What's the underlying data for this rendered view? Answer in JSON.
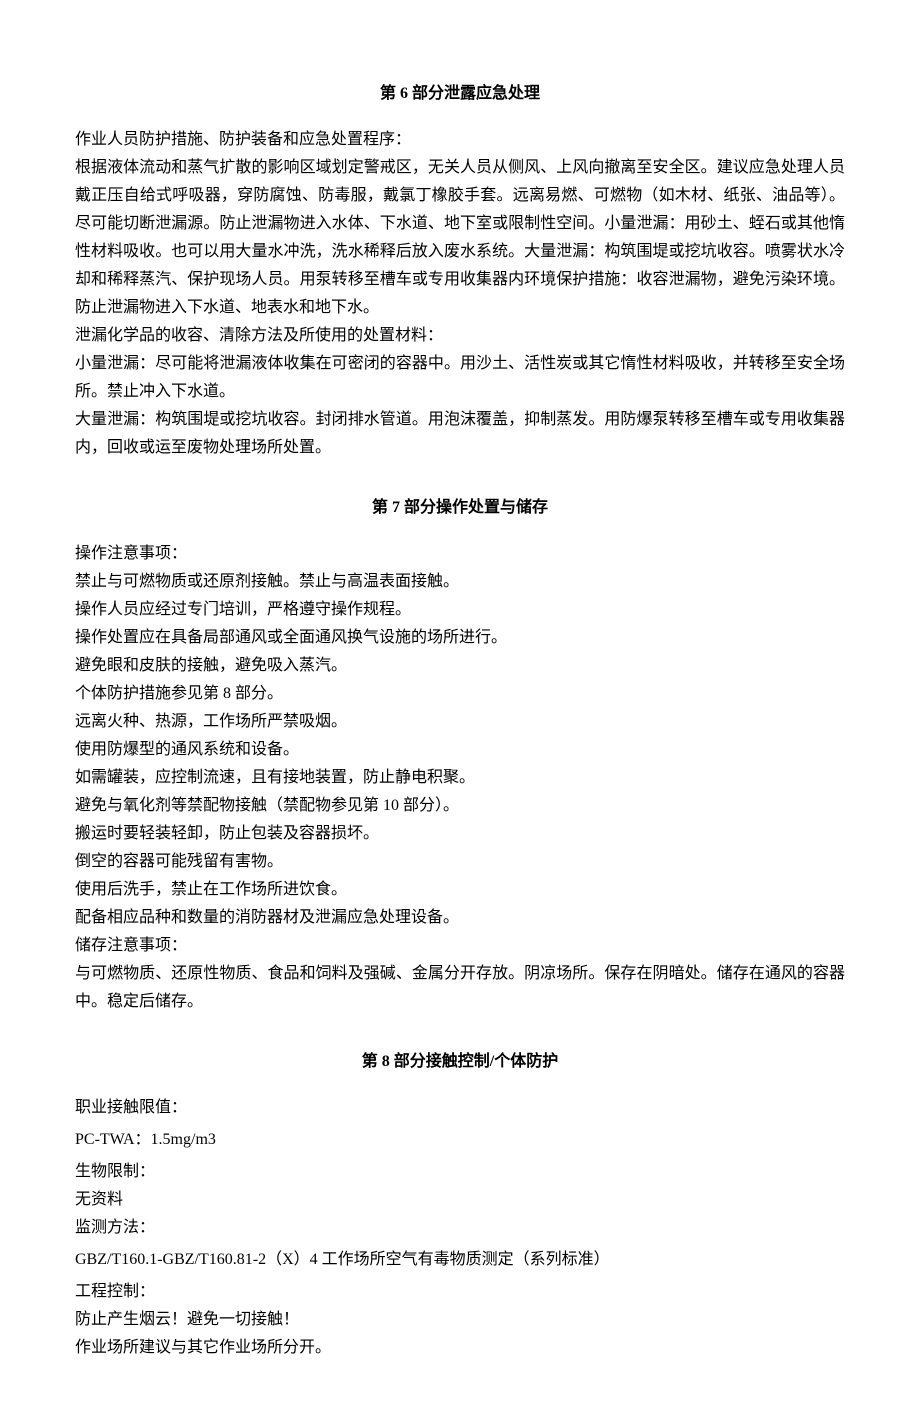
{
  "section6": {
    "title": "第 6 部分泄露应急处理",
    "p1_label": "作业人员防护措施、防护装备和应急处置程序：",
    "p1_body": "根据液体流动和蒸气扩散的影响区域划定警戒区，无关人员从侧风、上风向撤离至安全区。建议应急处理人员戴正压自给式呼吸器，穿防腐蚀、防毒服，戴氯丁橡胶手套。远离易燃、可燃物（如木材、纸张、油品等）。尽可能切断泄漏源。防止泄漏物进入水体、下水道、地下室或限制性空间。小量泄漏：用砂土、蛭石或其他惰性材料吸收。也可以用大量水冲洗，洗水稀释后放入废水系统。大量泄漏：构筑围堤或挖坑收容。喷雾状水冷却和稀释蒸汽、保护现场人员。用泵转移至槽车或专用收集器内环境保护措施：收容泄漏物，避免污染环境。防止泄漏物进入下水道、地表水和地下水。",
    "p2_label": "泄漏化学品的收容、清除方法及所使用的处置材料：",
    "p2_small": "小量泄漏：尽可能将泄漏液体收集在可密闭的容器中。用沙土、活性炭或其它惰性材料吸收，并转移至安全场所。禁止冲入下水道。",
    "p2_large": "大量泄漏：构筑围堤或挖坑收容。封闭排水管道。用泡沫覆盖，抑制蒸发。用防爆泵转移至槽车或专用收集器内，回收或运至废物处理场所处置。"
  },
  "section7": {
    "title": "第 7 部分操作处置与储存",
    "op_label": "操作注意事项：",
    "op_lines": [
      "禁止与可燃物质或还原剂接触。禁止与高温表面接触。",
      "操作人员应经过专门培训，严格遵守操作规程。",
      "操作处置应在具备局部通风或全面通风换气设施的场所进行。",
      "避免眼和皮肤的接触，避免吸入蒸汽。",
      "个体防护措施参见第 8 部分。",
      "远离火种、热源，工作场所严禁吸烟。",
      "使用防爆型的通风系统和设备。",
      "如需罐装，应控制流速，且有接地装置，防止静电积聚。",
      "避免与氧化剂等禁配物接触（禁配物参见第 10 部分）。",
      "搬运时要轻装轻卸，防止包装及容器损坏。",
      "倒空的容器可能残留有害物。",
      "使用后洗手，禁止在工作场所进饮食。",
      "配备相应品种和数量的消防器材及泄漏应急处理设备。"
    ],
    "store_label": "储存注意事项：",
    "store_body": "与可燃物质、还原性物质、食品和饲料及强碱、金属分开存放。阴凉场所。保存在阴暗处。储存在通风的容器中。稳定后储存。"
  },
  "section8": {
    "title": "第 8 部分接触控制/个体防护",
    "limit_label": "职业接触限值：",
    "limit_value": "PC-TWA：1.5mg/m3",
    "bio_label": "生物限制：",
    "bio_value": "无资料",
    "monitor_label": "监测方法：",
    "monitor_value": "GBZ/T160.1-GBZ/T160.81-2（X）4 工作场所空气有毒物质测定（系列标准）",
    "eng_label": "工程控制：",
    "eng_line1": "防止产生烟云！避免一切接触！",
    "eng_line2": "作业场所建议与其它作业场所分开。"
  }
}
